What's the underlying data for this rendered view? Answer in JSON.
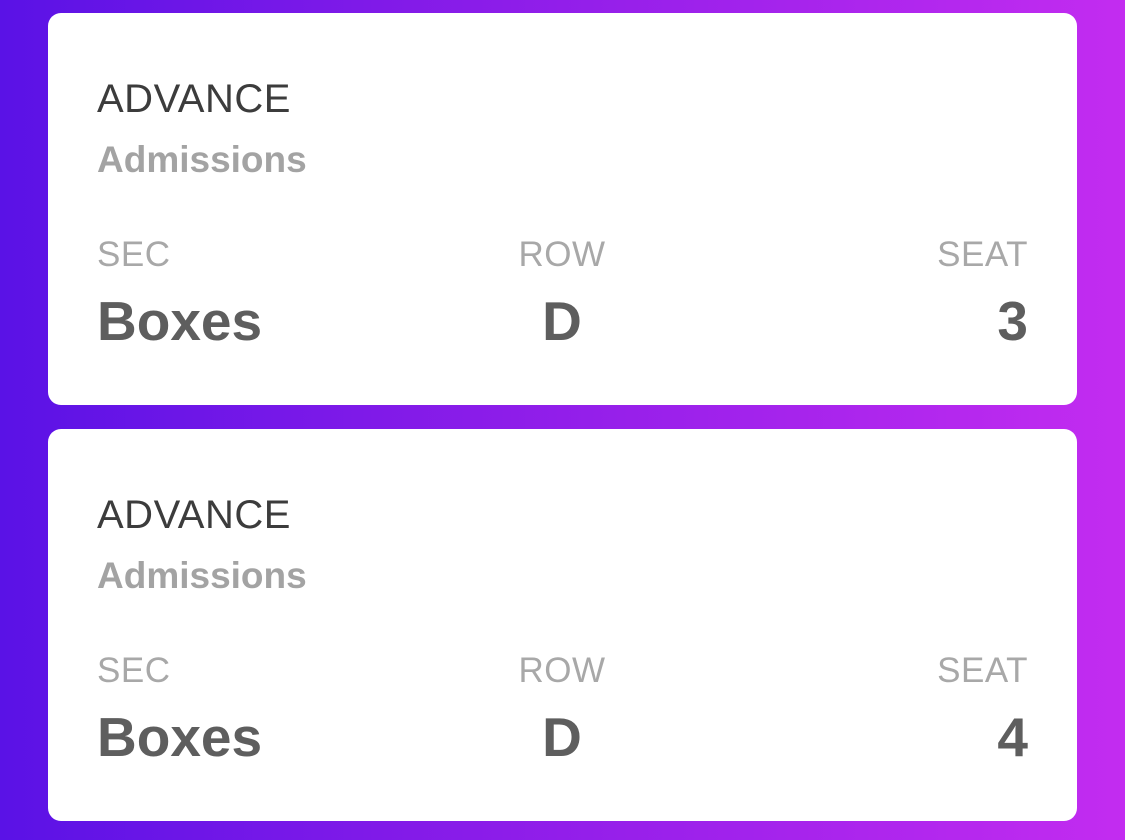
{
  "tickets": [
    {
      "type": "ADVANCE",
      "subtitle": "Admissions",
      "sec_label": "SEC",
      "sec_value": "Boxes",
      "row_label": "ROW",
      "row_value": "D",
      "seat_label": "SEAT",
      "seat_value": "3"
    },
    {
      "type": "ADVANCE",
      "subtitle": "Admissions",
      "sec_label": "SEC",
      "sec_value": "Boxes",
      "row_label": "ROW",
      "row_value": "D",
      "seat_label": "SEAT",
      "seat_value": "4"
    }
  ],
  "colors": {
    "background_start": "#5a12e6",
    "background_end": "#c32cf0",
    "card": "#ffffff",
    "title_text": "#3c3c3c",
    "muted_text": "#a8a8a8",
    "value_text": "#5e5e5e"
  }
}
